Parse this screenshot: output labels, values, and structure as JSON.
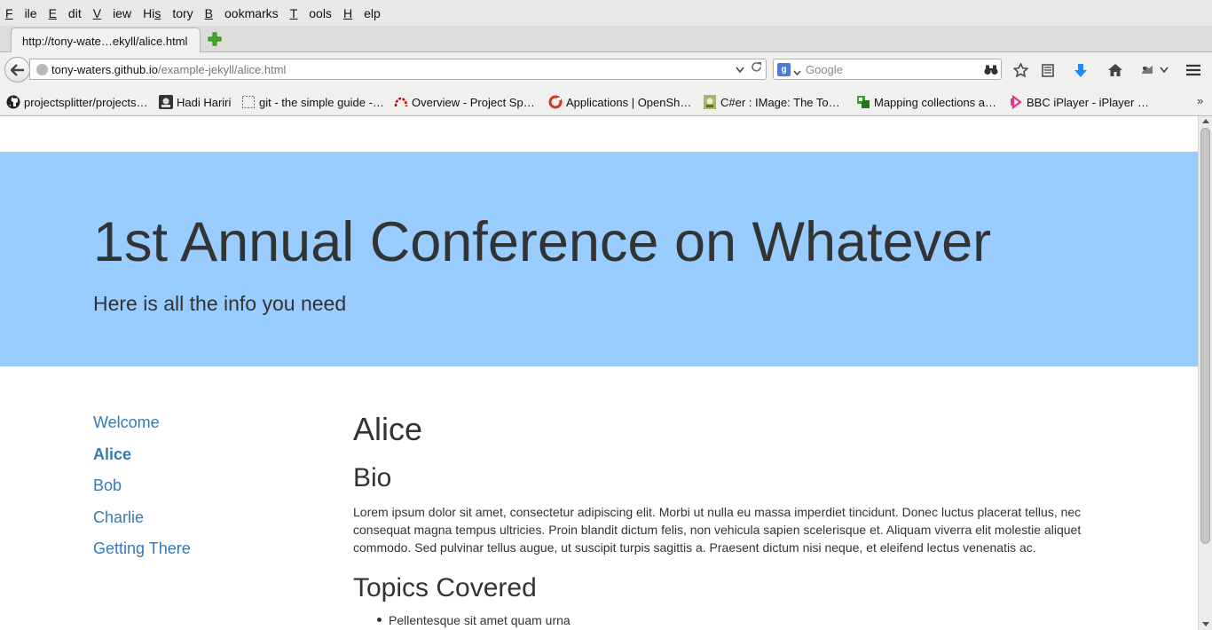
{
  "menu": [
    "File",
    "Edit",
    "View",
    "History",
    "Bookmarks",
    "Tools",
    "Help"
  ],
  "menu_underline": [
    "F",
    "E",
    "V",
    "s",
    "B",
    "T",
    "H"
  ],
  "tab": {
    "title": "http://tony-wate…ekyll/alice.html"
  },
  "address": {
    "host": "tony-waters.github.io",
    "path": "/example-jekyll/alice.html"
  },
  "search": {
    "placeholder": "Google",
    "engine_badge": "g"
  },
  "bookmarks": [
    {
      "label": "projectsplitter/projects…",
      "icon": "github-icon"
    },
    {
      "label": "Hadi Hariri",
      "icon": "hadi-favicon"
    },
    {
      "label": "git - the simple guide -…",
      "icon": "blank-page-icon"
    },
    {
      "label": "Overview - Project Sp…",
      "icon": "redhat-icon"
    },
    {
      "label": "Applications | OpenSh…",
      "icon": "openshift-icon"
    },
    {
      "label": "C#er : IMage: The To…",
      "icon": "csharper-icon"
    },
    {
      "label": "Mapping collections a…",
      "icon": "mapping-icon"
    },
    {
      "label": "BBC iPlayer - iPlayer …",
      "icon": "iplayer-icon"
    }
  ],
  "bookmarks_overflow": "»",
  "hero": {
    "title": "1st Annual Conference on Whatever",
    "subtitle": "Here is all the info you need"
  },
  "sidenav": [
    "Welcome",
    "Alice",
    "Bob",
    "Charlie",
    "Getting There"
  ],
  "sidenav_active": "Alice",
  "content": {
    "heading": "Alice",
    "bio_heading": "Bio",
    "bio": "Lorem ipsum dolor sit amet, consectetur adipiscing elit. Morbi ut nulla eu massa imperdiet tincidunt. Donec luctus placerat tellus, nec consequat magna tempus ultricies. Proin blandit dictum felis, non vehicula sapien scelerisque et. Aliquam viverra elit molestie aliquet commodo. Sed pulvinar tellus augue, ut suscipit turpis sagittis a. Praesent dictum nisi neque, et eleifend lectus venenatis ac.",
    "topics_heading": "Topics Covered",
    "topics": [
      "Pellentesque sit amet quam urna"
    ]
  },
  "colors": {
    "hero_bg": "#99ccff",
    "link": "#337ab7",
    "text": "#333333",
    "download_arrow": "#1a8cff"
  }
}
